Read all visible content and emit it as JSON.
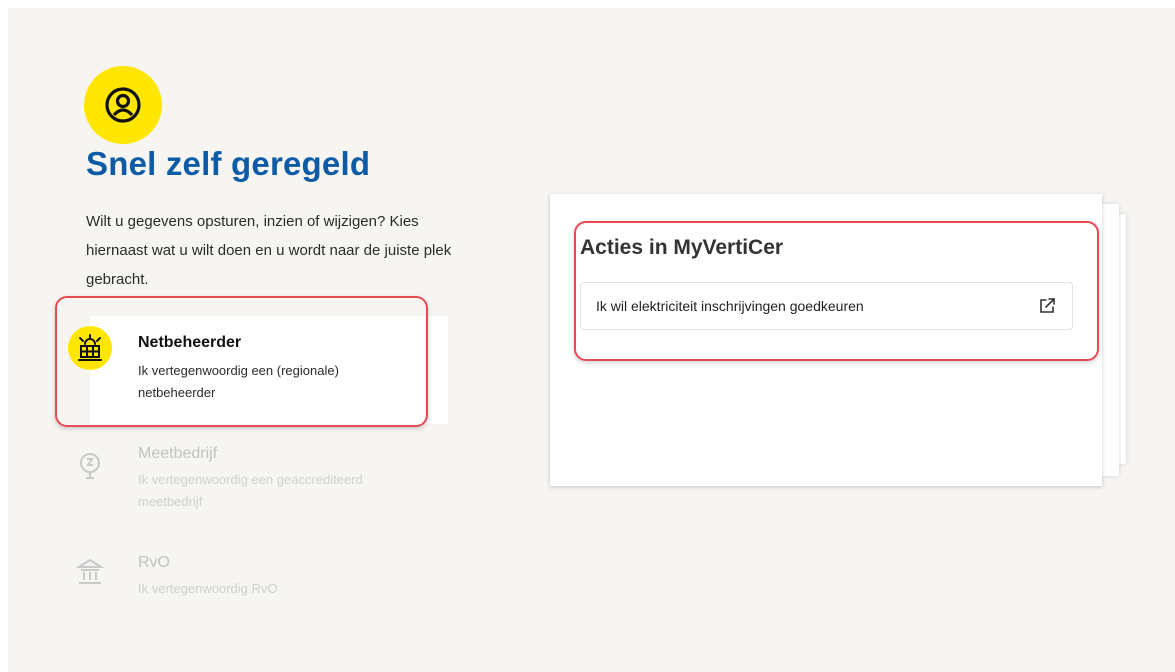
{
  "hero": {
    "icon": "user-circle-icon",
    "title": "Snel zelf geregeld",
    "intro": "Wilt u gegevens opsturen, inzien of wijzigen? Kies hiernaast wat u wilt doen en u wordt naar de juiste plek gebracht."
  },
  "roles": [
    {
      "icon": "solar-panel-icon",
      "title": "Netbeheerder",
      "description": "Ik vertegenwoordig een (regionale) netbeheerder",
      "selected": true
    },
    {
      "icon": "meter-icon",
      "title": "Meetbedrijf",
      "description": "Ik vertegenwoordig een geaccrediteerd meetbedrijf",
      "selected": false
    },
    {
      "icon": "government-building-icon",
      "title": "RvO",
      "description": "Ik vertegenwoordig RvO",
      "selected": false
    }
  ],
  "actions_card": {
    "title": "Acties in MyVertiCer",
    "actions": [
      {
        "label": "Ik wil elektriciteit inschrijvingen goedkeuren",
        "icon": "external-link-icon"
      }
    ]
  },
  "colors": {
    "brand_blue": "#0d5aa6",
    "accent_yellow": "#ffe600",
    "highlight_red": "#e64a53",
    "background": "#f7f5f2"
  }
}
